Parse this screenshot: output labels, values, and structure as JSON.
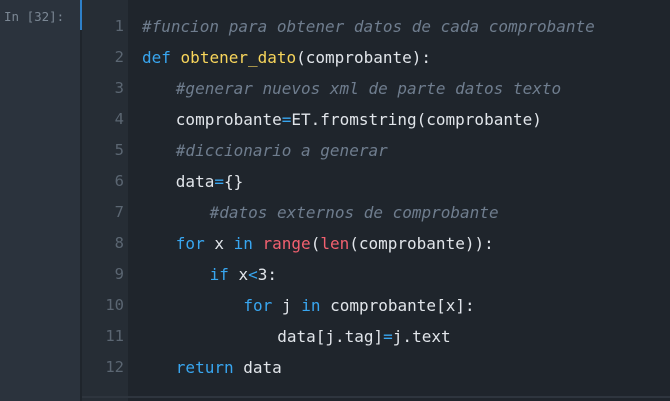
{
  "prompt": "In [32]:",
  "lines": [
    {
      "n": "1",
      "indent": 0,
      "tokens": [
        {
          "t": "comment",
          "v": "#funcion para obtener datos de cada comprobante"
        }
      ]
    },
    {
      "n": "2",
      "indent": 0,
      "tokens": [
        {
          "t": "kw",
          "v": "def"
        },
        {
          "t": "plain",
          "v": " "
        },
        {
          "t": "func",
          "v": "obtener_dato"
        },
        {
          "t": "plain",
          "v": "(comprobante):"
        }
      ]
    },
    {
      "n": "3",
      "indent": 4,
      "tokens": [
        {
          "t": "comment",
          "v": "#generar nuevos xml de parte datos texto"
        }
      ]
    },
    {
      "n": "4",
      "indent": 4,
      "tokens": [
        {
          "t": "plain",
          "v": "comprobante"
        },
        {
          "t": "op",
          "v": "="
        },
        {
          "t": "plain",
          "v": "ET.fromstring(comprobante)"
        }
      ]
    },
    {
      "n": "5",
      "indent": 4,
      "tokens": [
        {
          "t": "comment",
          "v": "#diccionario a generar"
        }
      ]
    },
    {
      "n": "6",
      "indent": 4,
      "tokens": [
        {
          "t": "plain",
          "v": "data"
        },
        {
          "t": "op",
          "v": "="
        },
        {
          "t": "plain",
          "v": "{}"
        }
      ]
    },
    {
      "n": "7",
      "indent": 8,
      "tokens": [
        {
          "t": "comment",
          "v": "#datos externos de comprobante"
        }
      ]
    },
    {
      "n": "8",
      "indent": 4,
      "tokens": [
        {
          "t": "kw",
          "v": "for"
        },
        {
          "t": "plain",
          "v": " x "
        },
        {
          "t": "kw",
          "v": "in"
        },
        {
          "t": "plain",
          "v": " "
        },
        {
          "t": "builtin",
          "v": "range"
        },
        {
          "t": "plain",
          "v": "("
        },
        {
          "t": "builtin",
          "v": "len"
        },
        {
          "t": "plain",
          "v": "(comprobante)):"
        }
      ]
    },
    {
      "n": "9",
      "indent": 8,
      "tokens": [
        {
          "t": "kw",
          "v": "if"
        },
        {
          "t": "plain",
          "v": " x"
        },
        {
          "t": "op",
          "v": "<"
        },
        {
          "t": "num",
          "v": "3"
        },
        {
          "t": "plain",
          "v": ":"
        }
      ]
    },
    {
      "n": "10",
      "indent": 12,
      "tokens": [
        {
          "t": "kw",
          "v": "for"
        },
        {
          "t": "plain",
          "v": " j "
        },
        {
          "t": "kw",
          "v": "in"
        },
        {
          "t": "plain",
          "v": " comprobante[x]:"
        }
      ]
    },
    {
      "n": "11",
      "indent": 16,
      "tokens": [
        {
          "t": "plain",
          "v": "data[j.tag]"
        },
        {
          "t": "op",
          "v": "="
        },
        {
          "t": "plain",
          "v": "j.text"
        }
      ]
    },
    {
      "n": "12",
      "indent": 4,
      "tokens": [
        {
          "t": "kw",
          "v": "return"
        },
        {
          "t": "plain",
          "v": " data"
        }
      ]
    }
  ],
  "colors": {
    "background": "#2b333d",
    "cell_background": "#1f252c",
    "gutter": "#262d35",
    "accent": "#2e80c9",
    "comment": "#6f7d8e",
    "keyword": "#38a6f0",
    "function_name": "#f7d55b",
    "builtin": "#f2606f",
    "text": "#e1e5ea"
  }
}
